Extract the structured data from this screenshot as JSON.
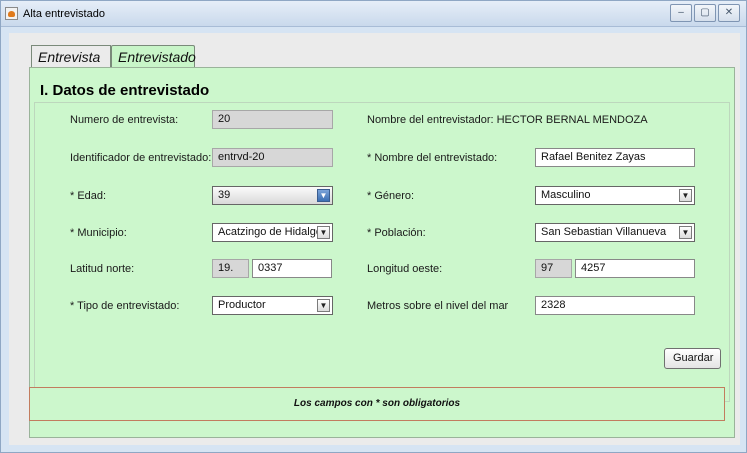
{
  "window": {
    "title": "Alta entrevistado",
    "controls": [
      "–",
      "▢",
      "✕"
    ]
  },
  "tabs": [
    {
      "label": "Entrevista",
      "active": false
    },
    {
      "label": "Entrevistado",
      "active": true
    }
  ],
  "section": {
    "title": "I.  Datos de entrevistado"
  },
  "form": {
    "numero_label": "Numero de entrevista:",
    "numero_value": "20",
    "entrevistador_label": "Nombre del entrevistador: HECTOR BERNAL MENDOZA",
    "identificador_label": "Identificador de entrevistado:",
    "identificador_value": "entrvd-20",
    "nombre_label": "* Nombre del entrevistado:",
    "nombre_value": "Rafael Benitez Zayas",
    "edad_label": "* Edad:",
    "edad_value": "39",
    "genero_label": "* Género:",
    "genero_value": "Masculino",
    "municipio_label": "* Municipio:",
    "municipio_value": "Acatzingo de Hidalgo",
    "poblacion_label": "* Población:",
    "poblacion_value": "San Sebastian Villanueva",
    "latitud_label": "Latitud norte:",
    "latitud_deg": "19.",
    "latitud_min": "0337",
    "longitud_label": "Longitud oeste:",
    "longitud_deg": "97",
    "longitud_min": "4257",
    "tipo_label": "* Tipo de entrevistado:",
    "tipo_value": "Productor",
    "metros_label": "Metros sobre el nivel del mar",
    "metros_value": "2328",
    "guardar_label": "Guardar"
  },
  "footer": {
    "note": "Los campos con * son obligatorios"
  },
  "colors": {
    "panel": "#ccf7cc",
    "note_border": "#c27c5e"
  }
}
